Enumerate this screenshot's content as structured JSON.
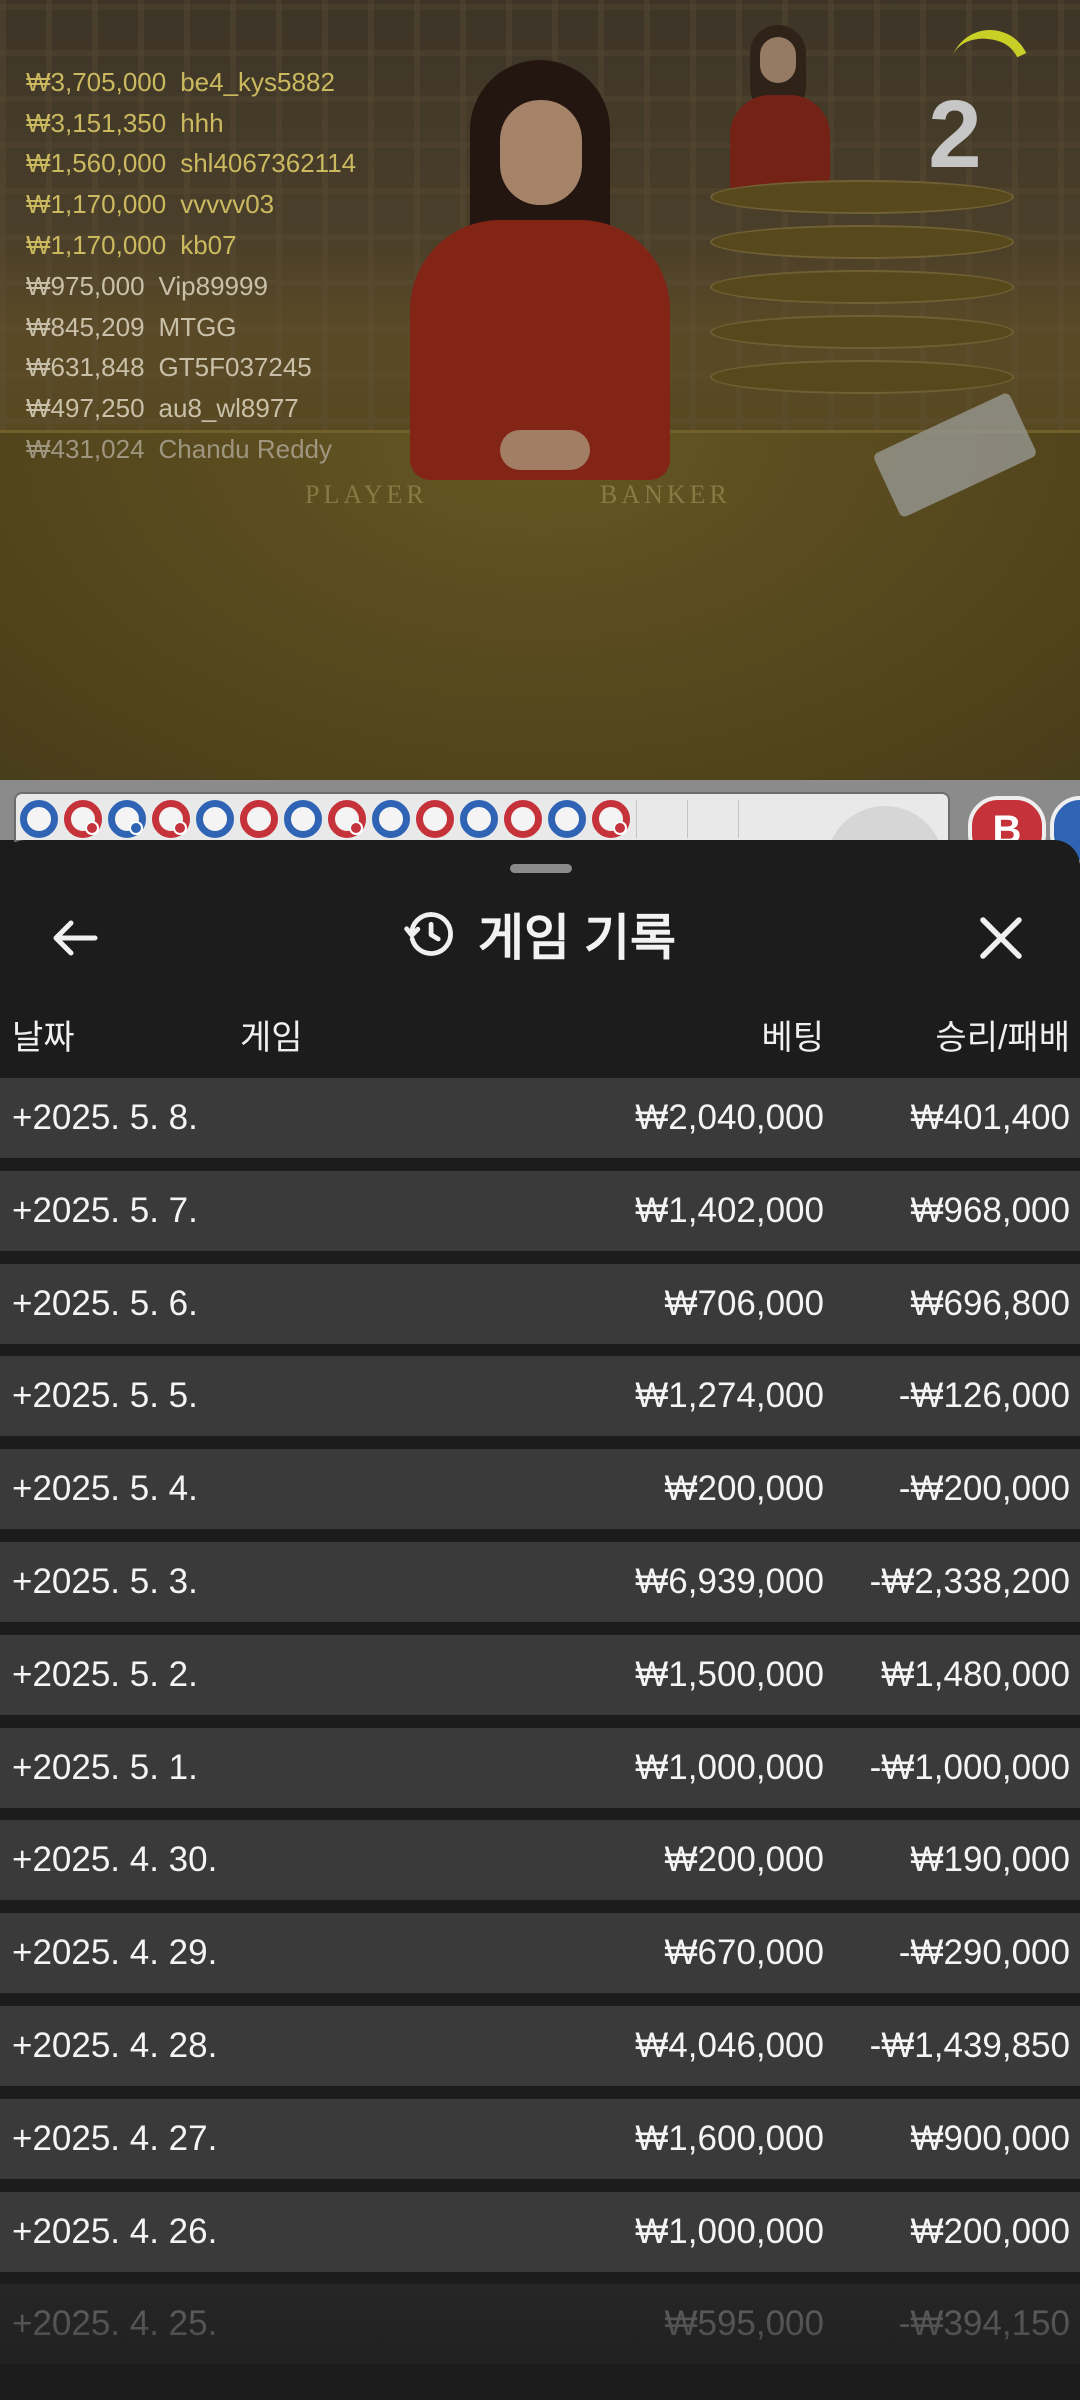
{
  "video": {
    "table_labels": [
      "PLAYER",
      "BANKER"
    ],
    "countdown": "2",
    "winners": [
      {
        "amount": "₩3,705,000",
        "name": "be4_kys5882",
        "style": "gold"
      },
      {
        "amount": "₩3,151,350",
        "name": "hhh",
        "style": "gold"
      },
      {
        "amount": "₩1,560,000",
        "name": "shl4067362114",
        "style": "gold"
      },
      {
        "amount": "₩1,170,000",
        "name": "vvvvv03",
        "style": "gold"
      },
      {
        "amount": "₩1,170,000",
        "name": "kb07",
        "style": "gold"
      },
      {
        "amount": "₩975,000",
        "name": "Vip89999",
        "style": "plain"
      },
      {
        "amount": "₩845,209",
        "name": "MTGG",
        "style": "plain"
      },
      {
        "amount": "₩631,848",
        "name": "GT5F037245",
        "style": "plain"
      },
      {
        "amount": "₩497,250",
        "name": "au8_wl8977",
        "style": "plain"
      },
      {
        "amount": "₩431,024",
        "name": "Chandu Reddy",
        "style": "faded"
      }
    ]
  },
  "roadmap": {
    "beads": [
      "b",
      "r-pair",
      "b-pair",
      "r-pair",
      "b",
      "r",
      "b",
      "r-pair",
      "b",
      "r",
      "b",
      "r",
      "b",
      "r-pair"
    ],
    "badge_label": "B"
  },
  "sheet": {
    "title": "게임 기록",
    "icons": {
      "back": "arrow-left-icon",
      "history": "history-clock-icon",
      "close": "close-x-icon"
    },
    "columns": {
      "date": "날짜",
      "game": "게임",
      "bet": "베팅",
      "result": "승리/패배"
    },
    "rows": [
      {
        "date": "+2025. 5. 8.",
        "bet": "₩2,040,000",
        "result": "₩401,400"
      },
      {
        "date": "+2025. 5. 7.",
        "bet": "₩1,402,000",
        "result": "₩968,000"
      },
      {
        "date": "+2025. 5. 6.",
        "bet": "₩706,000",
        "result": "₩696,800"
      },
      {
        "date": "+2025. 5. 5.",
        "bet": "₩1,274,000",
        "result": "-₩126,000"
      },
      {
        "date": "+2025. 5. 4.",
        "bet": "₩200,000",
        "result": "-₩200,000"
      },
      {
        "date": "+2025. 5. 3.",
        "bet": "₩6,939,000",
        "result": "-₩2,338,200"
      },
      {
        "date": "+2025. 5. 2.",
        "bet": "₩1,500,000",
        "result": "₩1,480,000"
      },
      {
        "date": "+2025. 5. 1.",
        "bet": "₩1,000,000",
        "result": "-₩1,000,000"
      },
      {
        "date": "+2025. 4. 30.",
        "bet": "₩200,000",
        "result": "₩190,000"
      },
      {
        "date": "+2025. 4. 29.",
        "bet": "₩670,000",
        "result": "-₩290,000"
      },
      {
        "date": "+2025. 4. 28.",
        "bet": "₩4,046,000",
        "result": "-₩1,439,850"
      },
      {
        "date": "+2025. 4. 27.",
        "bet": "₩1,600,000",
        "result": "₩900,000"
      },
      {
        "date": "+2025. 4. 26.",
        "bet": "₩1,000,000",
        "result": "₩200,000"
      },
      {
        "date": "+2025. 4. 25.",
        "bet": "₩595,000",
        "result": "-₩394,150"
      }
    ]
  }
}
